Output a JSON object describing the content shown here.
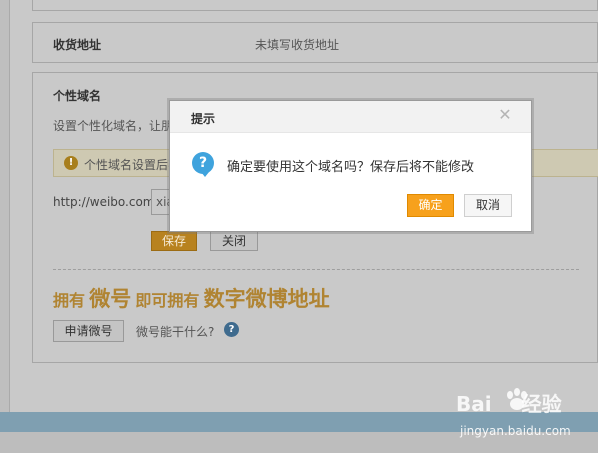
{
  "settings": {
    "address": {
      "label": "收货地址",
      "value": "未填写收货地址"
    },
    "domain": {
      "title": "个性域名",
      "description": "设置个性化域名，让朋",
      "warning": "个性域名设置后不",
      "url_prefix": "http://weibo.com/",
      "input_value": "xia",
      "save_label": "保存",
      "close_label": "关闭"
    },
    "promo": {
      "part1": "拥有",
      "part2": "微号",
      "part3": "即可拥有",
      "part4": "数字微博地址"
    },
    "apply_label": "申请微号",
    "what_link": "微号能干什么?"
  },
  "dialog": {
    "title": "提示",
    "message": "确定要使用这个域名吗？保存后将不能修改",
    "confirm_label": "确定",
    "cancel_label": "取消"
  },
  "watermark": {
    "brand_left": "Bai",
    "brand_right": "经验",
    "url": "jingyan.baidu.com"
  },
  "icons": {
    "warning": "exclamation-circle-icon",
    "help": "question-circle-icon",
    "dialog": "question-bubble-icon",
    "close": "close-icon"
  },
  "colors": {
    "accent_orange": "#f7a11c",
    "info_blue": "#3fa3dd",
    "promo_gold": "#b08432"
  }
}
